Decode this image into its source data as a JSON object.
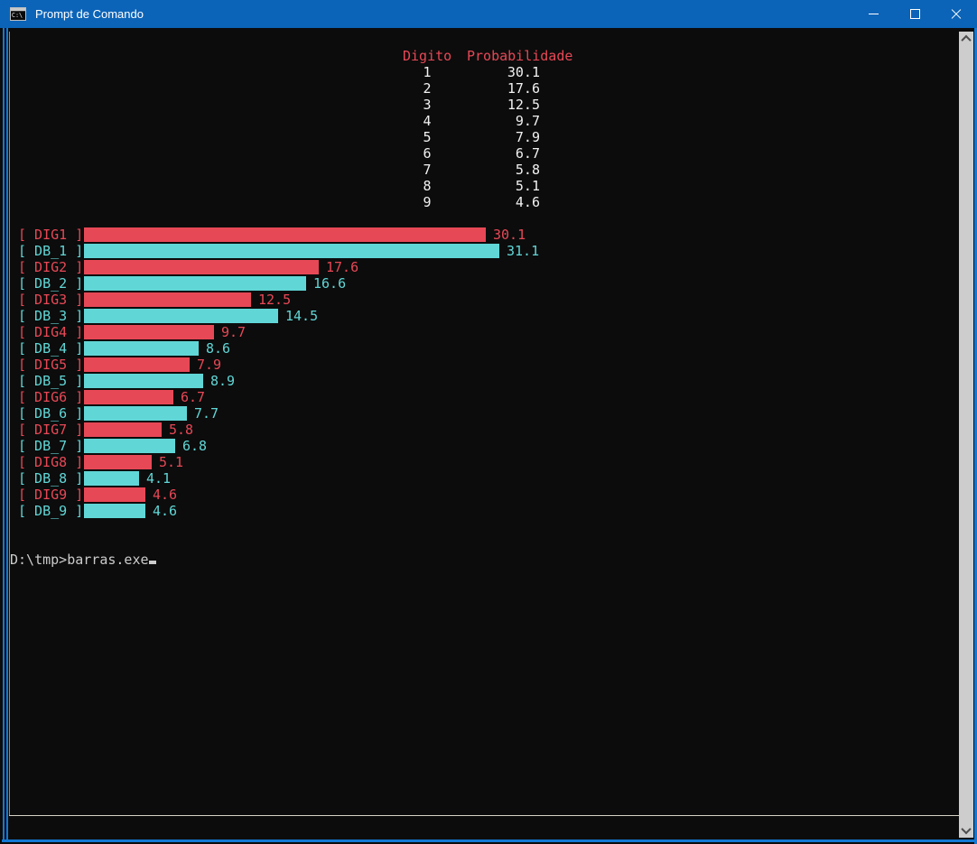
{
  "window": {
    "title": "Prompt de Comando"
  },
  "titlebar": {
    "controls": [
      "minimize",
      "maximize",
      "close"
    ]
  },
  "icons": {
    "app": "cmd-window-icon",
    "cmd_glyph": "C:\\",
    "scroll_up": "chevron-up",
    "scroll_down": "chevron-down"
  },
  "table": {
    "headers": [
      "Digito",
      "Probabilidade"
    ],
    "rows": [
      {
        "digit": "1",
        "prob": "30.1"
      },
      {
        "digit": "2",
        "prob": "17.6"
      },
      {
        "digit": "3",
        "prob": "12.5"
      },
      {
        "digit": "4",
        "prob": "9.7"
      },
      {
        "digit": "5",
        "prob": "7.9"
      },
      {
        "digit": "6",
        "prob": "6.7"
      },
      {
        "digit": "7",
        "prob": "5.8"
      },
      {
        "digit": "8",
        "prob": "5.1"
      },
      {
        "digit": "9",
        "prob": "4.6"
      }
    ]
  },
  "chart_data": {
    "type": "bar",
    "orientation": "horizontal",
    "categories": [
      1,
      2,
      3,
      4,
      5,
      6,
      7,
      8,
      9
    ],
    "series": [
      {
        "name": "DIG",
        "color": "#e74856",
        "labels": [
          "[ DIG1 ]",
          "[ DIG2 ]",
          "[ DIG3 ]",
          "[ DIG4 ]",
          "[ DIG5 ]",
          "[ DIG6 ]",
          "[ DIG7 ]",
          "[ DIG8 ]",
          "[ DIG9 ]"
        ],
        "values": [
          30.1,
          17.6,
          12.5,
          9.7,
          7.9,
          6.7,
          5.8,
          5.1,
          4.6
        ]
      },
      {
        "name": "DB",
        "color": "#61d6d6",
        "labels": [
          "[ DB_1 ]",
          "[ DB_2 ]",
          "[ DB_3 ]",
          "[ DB_4 ]",
          "[ DB_5 ]",
          "[ DB_6 ]",
          "[ DB_7 ]",
          "[ DB_8 ]",
          "[ DB_9 ]"
        ],
        "values": [
          31.1,
          16.6,
          14.5,
          8.6,
          8.9,
          7.7,
          6.8,
          4.1,
          4.6
        ]
      }
    ],
    "value_format": "one-decimal",
    "xlim": [
      0,
      35
    ],
    "grid": false,
    "legend": "none (labels inline left, values inline right of each bar)"
  },
  "prompt": {
    "text": "D:\\tmp>barras.exe",
    "cursor": "underscore-block"
  },
  "colors": {
    "titlebar": "#0b64b8",
    "accent": "#1379d4",
    "console_bg": "#0c0c0c",
    "red": "#e74856",
    "cyan": "#61d6d6",
    "text": "#cccccc",
    "value_text": "#f2f2f2",
    "scrollbar_track": "#cdcdcd",
    "scrollbar_arrow": "#4d4d4d",
    "tan_edge": "#b5814f",
    "console_bottom_line": "#d8d2c6"
  }
}
